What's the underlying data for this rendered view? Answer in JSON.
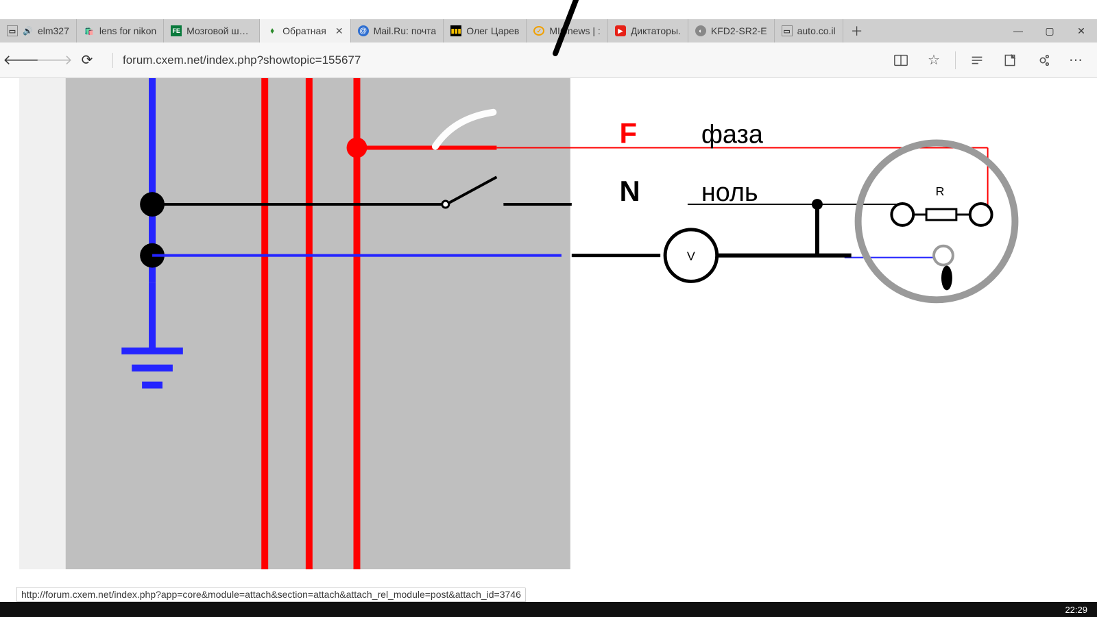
{
  "tabs": [
    {
      "label": "elm327",
      "fav": "▭",
      "favbg": "#fff",
      "favcolor": "#333"
    },
    {
      "label": "lens for nikon",
      "fav": "🛍",
      "favbg": "#fff",
      "favcolor": "#9b1b1b"
    },
    {
      "label": "Мозговой штурм",
      "fav": "FE",
      "favbg": "#0a7a3d",
      "favcolor": "#fff"
    },
    {
      "label": "Обратная",
      "fav": "✦",
      "favbg": "#fff",
      "favcolor": "#2a8a2a",
      "active": true,
      "closable": true
    },
    {
      "label": "Mail.Ru: почта",
      "fav": "@",
      "favbg": "#2f6fd1",
      "favcolor": "#fff"
    },
    {
      "label": "Олег Царев",
      "fav": "▮▮▮",
      "favbg": "#000",
      "favcolor": "#f5c000"
    },
    {
      "label": "MIGnews | :",
      "fav": "✓",
      "favbg": "#fff",
      "favcolor": "#f0a000"
    },
    {
      "label": "Диктаторы.",
      "fav": "▶",
      "favbg": "#e62117",
      "favcolor": "#fff"
    },
    {
      "label": "KFD2-SR2-E",
      "fav": "◐",
      "favbg": "#888",
      "favcolor": "#fff"
    },
    {
      "label": "auto.co.il",
      "fav": "▭",
      "favbg": "#fff",
      "favcolor": "#333"
    }
  ],
  "url": "forum.cxem.net/index.php?showtopic=155677",
  "status_url": "http://forum.cxem.net/index.php?app=core&module=attach&section=attach&attach_rel_module=post&attach_id=3746",
  "clock": "22:29",
  "diagram": {
    "F": "F",
    "F_label": "фаза",
    "N": "N",
    "N_label": "ноль",
    "V": "V",
    "R": "R"
  }
}
